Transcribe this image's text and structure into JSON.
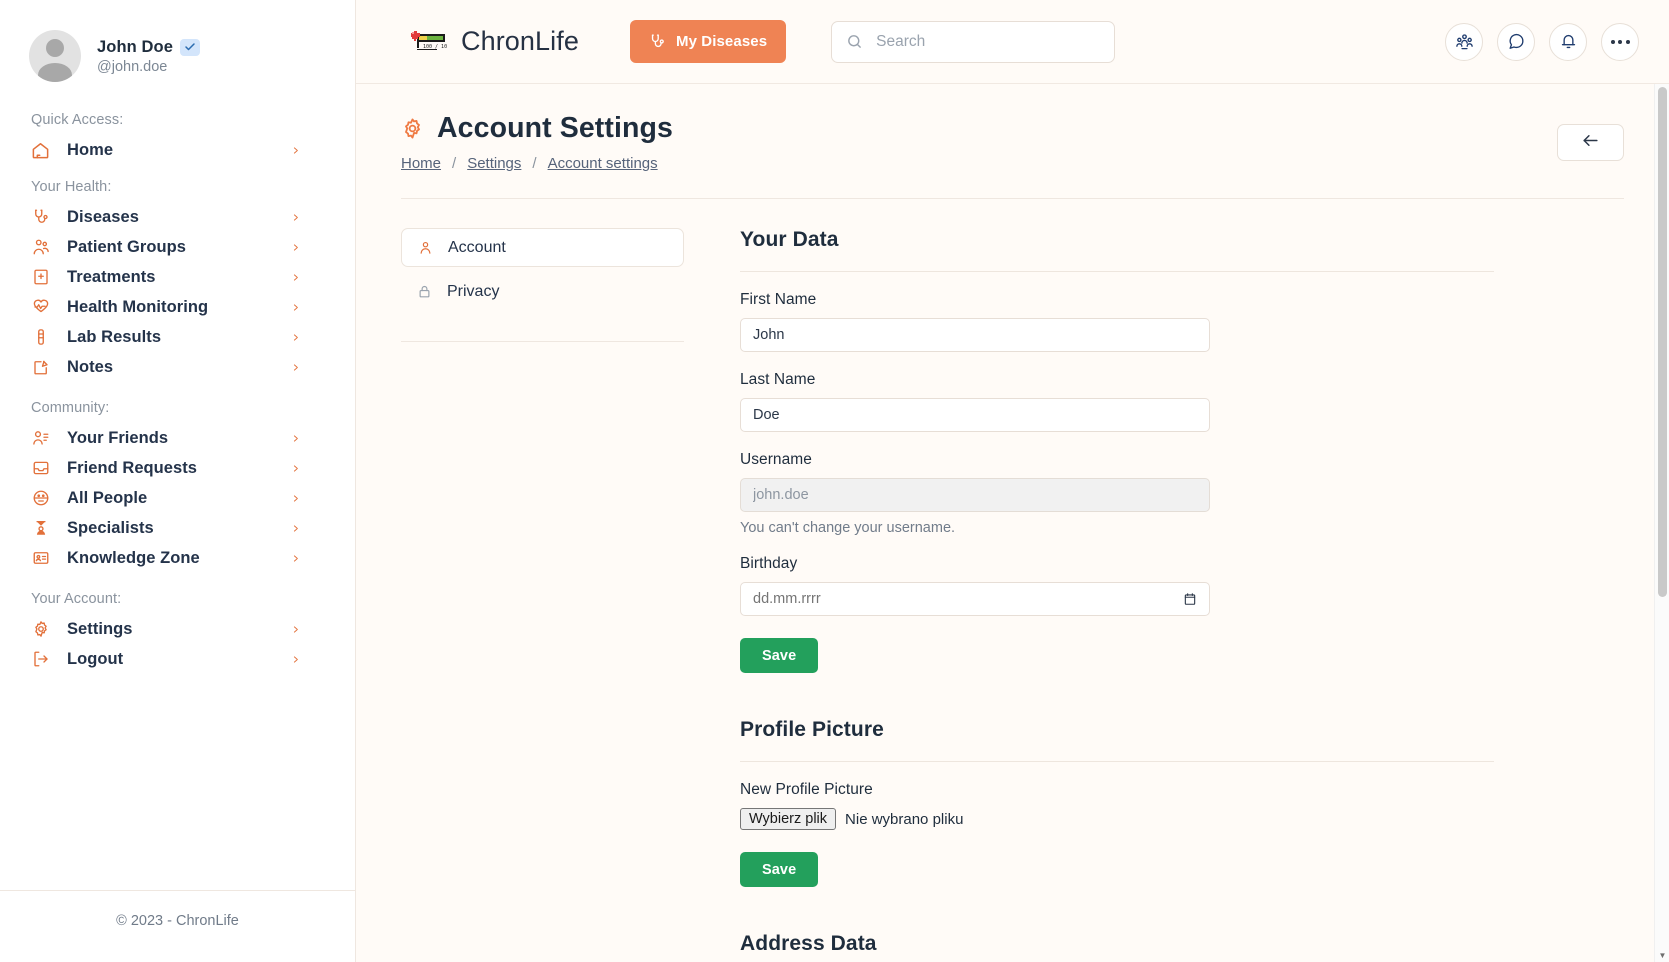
{
  "brand": {
    "name": "ChronLife",
    "logo_icon": "pixel-health-bar-icon",
    "logo_score": "100 / 100"
  },
  "topbar": {
    "my_diseases_label": "My Diseases",
    "my_diseases_icon": "stethoscope-icon",
    "search_placeholder": "Search",
    "search_value": "",
    "search_icon": "search-icon",
    "actions": [
      {
        "name": "people-icon",
        "label": "People"
      },
      {
        "name": "chat-bubble-icon",
        "label": "Messages"
      },
      {
        "name": "bell-icon",
        "label": "Notifications"
      },
      {
        "name": "more-dots-icon",
        "label": "More"
      }
    ]
  },
  "sidebar": {
    "user": {
      "name": "John Doe",
      "handle": "@john.doe",
      "verified_icon": "verified-check-icon",
      "avatar_icon": "default-avatar-icon"
    },
    "groups": [
      {
        "label": "Quick Access:",
        "items": [
          {
            "label": "Home",
            "icon": "home-icon"
          }
        ]
      },
      {
        "label": "Your Health:",
        "items": [
          {
            "label": "Diseases",
            "icon": "stethoscope-icon"
          },
          {
            "label": "Patient Groups",
            "icon": "users-group-icon"
          },
          {
            "label": "Treatments",
            "icon": "hospital-icon"
          },
          {
            "label": "Health Monitoring",
            "icon": "heart-pulse-icon"
          },
          {
            "label": "Lab Results",
            "icon": "test-tube-icon"
          },
          {
            "label": "Notes",
            "icon": "note-edit-icon"
          }
        ]
      },
      {
        "label": "Community:",
        "items": [
          {
            "label": "Your Friends",
            "icon": "user-list-icon"
          },
          {
            "label": "Friend Requests",
            "icon": "inbox-icon"
          },
          {
            "label": "All People",
            "icon": "smiley-face-icon"
          },
          {
            "label": "Specialists",
            "icon": "doctor-icon"
          },
          {
            "label": "Knowledge Zone",
            "icon": "id-card-icon"
          }
        ]
      },
      {
        "label": "Your Account:",
        "items": [
          {
            "label": "Settings",
            "icon": "gear-icon"
          },
          {
            "label": "Logout",
            "icon": "logout-icon"
          }
        ]
      }
    ],
    "chevron_icon": "chevron-right-icon",
    "footer": "© 2023 - ChronLife"
  },
  "page": {
    "title": "Account Settings",
    "title_icon": "gear-icon",
    "breadcrumb": [
      {
        "label": "Home",
        "link": true
      },
      {
        "label": "/",
        "link": false
      },
      {
        "label": "Settings",
        "link": true
      },
      {
        "label": "/",
        "link": false
      },
      {
        "label": "Account settings",
        "link": true
      }
    ],
    "back_icon": "arrow-left-icon"
  },
  "settings_tabs": [
    {
      "label": "Account",
      "icon": "user-icon",
      "active": true
    },
    {
      "label": "Privacy",
      "icon": "lock-icon",
      "active": false
    }
  ],
  "sections": {
    "your_data": {
      "title": "Your Data",
      "fields": {
        "first_name": {
          "label": "First Name",
          "value": "John",
          "placeholder": ""
        },
        "last_name": {
          "label": "Last Name",
          "value": "Doe",
          "placeholder": ""
        },
        "username": {
          "label": "Username",
          "value": "john.doe",
          "helper": "You can't change your username.",
          "disabled": true
        },
        "birthday": {
          "label": "Birthday",
          "value": "",
          "placeholder": "dd.mm.rrrr",
          "calendar_icon": "calendar-icon"
        }
      },
      "save_label": "Save"
    },
    "profile_picture": {
      "title": "Profile Picture",
      "field_label": "New Profile Picture",
      "file_button_label": "Wybierz plik",
      "file_status": "Nie wybrano pliku",
      "save_label": "Save"
    },
    "address_data": {
      "title": "Address Data"
    }
  },
  "colors": {
    "accent": "#ef8354",
    "accent_icon": "#e2703a",
    "save_green": "#23a05c",
    "page_bg": "#fffbf7",
    "text": "#1f2d3d",
    "muted": "#8a939e"
  }
}
